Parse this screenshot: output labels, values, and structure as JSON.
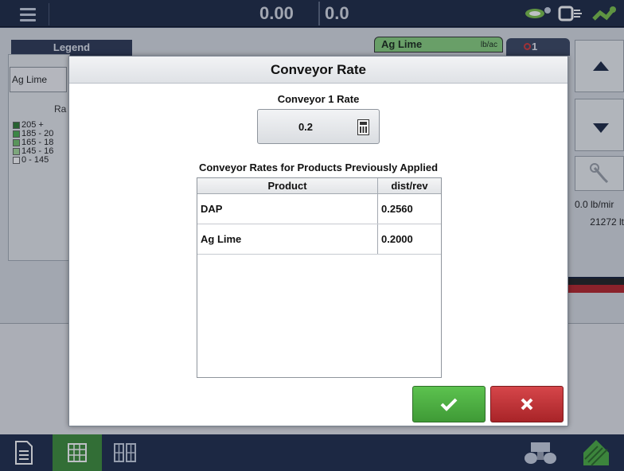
{
  "topbar": {
    "speed_value": "0.00",
    "rate_value": "0.0"
  },
  "legend": {
    "tab_label": "Legend",
    "product_button": "Ag Lime",
    "rate_label": "Ra",
    "ranges": [
      {
        "label": "205 +",
        "color": "#2e7d32"
      },
      {
        "label": "185 - 20",
        "color": "#4caf50"
      },
      {
        "label": "165 - 18",
        "color": "#74c46d"
      },
      {
        "label": "145 - 16",
        "color": "#a5dc9a"
      },
      {
        "label": "0 - 145",
        "color": "#ffffff"
      }
    ]
  },
  "product_tab": {
    "label": "Ag Lime",
    "unit": "lb/ac"
  },
  "alarm_tab": {
    "count": "1"
  },
  "side_panel": {
    "rate_text": "0.0 lb/mir",
    "weight_text": "21272 lt"
  },
  "modal": {
    "title": "Conveyor Rate",
    "rate_label": "Conveyor 1 Rate",
    "rate_value": "0.2",
    "table_label": "Conveyor Rates for Products Previously Applied",
    "table": {
      "columns": [
        "Product",
        "dist/rev"
      ],
      "rows": [
        {
          "product": "DAP",
          "dist": "0.2560"
        },
        {
          "product": "Ag Lime",
          "dist": "0.2000"
        }
      ]
    }
  },
  "colors": {
    "accept": "#4cae42",
    "cancel": "#c0353a",
    "nav_active": "#3d8e3a",
    "bar": "#1e2a44"
  },
  "icons": {
    "menu": "hamburger-icon",
    "calculator": "calculator-icon",
    "accept": "checkmark-icon",
    "cancel": "x-icon"
  }
}
